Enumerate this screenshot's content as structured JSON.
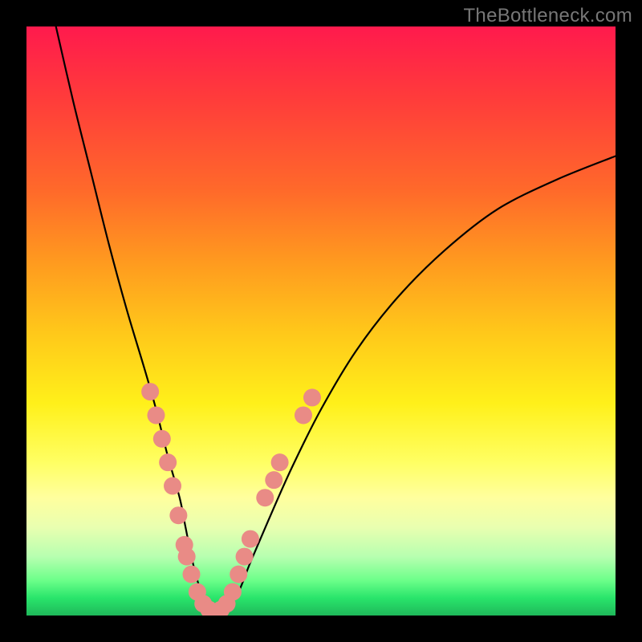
{
  "watermark": "TheBottleneck.com",
  "chart_data": {
    "type": "line",
    "title": "",
    "xlabel": "",
    "ylabel": "",
    "xlim": [
      0,
      100
    ],
    "ylim": [
      0,
      100
    ],
    "legend": false,
    "grid": false,
    "series": [
      {
        "name": "bottleneck-curve",
        "x": [
          5,
          8,
          11,
          14,
          17,
          20,
          22,
          24,
          26,
          27,
          28,
          29,
          30,
          31,
          32,
          34,
          36,
          38,
          41,
          45,
          50,
          56,
          63,
          71,
          80,
          90,
          100
        ],
        "y": [
          100,
          87,
          75,
          63,
          52,
          42,
          35,
          27,
          20,
          15,
          10,
          6,
          3,
          1,
          0.5,
          1,
          4,
          9,
          16,
          25,
          35,
          45,
          54,
          62,
          69,
          74,
          78
        ]
      }
    ],
    "markers": {
      "name": "highlight-points",
      "color": "#e98b86",
      "radius_px": 11,
      "points": [
        {
          "x": 21.0,
          "y": 38
        },
        {
          "x": 22.0,
          "y": 34
        },
        {
          "x": 23.0,
          "y": 30
        },
        {
          "x": 24.0,
          "y": 26
        },
        {
          "x": 24.8,
          "y": 22
        },
        {
          "x": 25.8,
          "y": 17
        },
        {
          "x": 26.8,
          "y": 12
        },
        {
          "x": 27.2,
          "y": 10
        },
        {
          "x": 28.0,
          "y": 7
        },
        {
          "x": 29.0,
          "y": 4
        },
        {
          "x": 30.0,
          "y": 2
        },
        {
          "x": 31.0,
          "y": 1
        },
        {
          "x": 33.0,
          "y": 1
        },
        {
          "x": 34.0,
          "y": 2
        },
        {
          "x": 35.0,
          "y": 4
        },
        {
          "x": 36.0,
          "y": 7
        },
        {
          "x": 37.0,
          "y": 10
        },
        {
          "x": 38.0,
          "y": 13
        },
        {
          "x": 40.5,
          "y": 20
        },
        {
          "x": 42.0,
          "y": 23
        },
        {
          "x": 43.0,
          "y": 26
        },
        {
          "x": 47.0,
          "y": 34
        },
        {
          "x": 48.5,
          "y": 37
        }
      ]
    },
    "background": "vertical-gradient-red-to-green"
  }
}
